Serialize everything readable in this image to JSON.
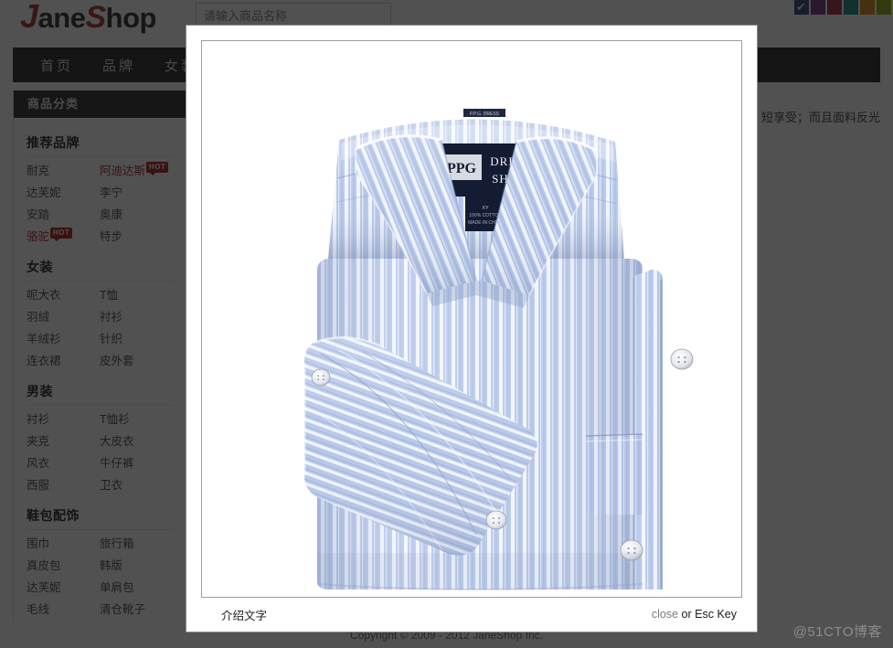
{
  "site": {
    "logo": {
      "prefix": "J",
      "middle": "ane",
      "accent": "S",
      "suffix": "hop"
    },
    "search": {
      "value": "",
      "placeholder": "请输入商品名称"
    },
    "nav": [
      {
        "label": "首页"
      },
      {
        "label": "品牌"
      },
      {
        "label": "女装"
      }
    ],
    "swatches": [
      {
        "name": "swatch-navy",
        "color": "#1b3a73",
        "selected": true,
        "check": "✔"
      },
      {
        "name": "swatch-purple",
        "color": "#6d1f7a"
      },
      {
        "name": "swatch-crimson",
        "color": "#9d1430"
      },
      {
        "name": "swatch-teal",
        "color": "#0d7f80"
      },
      {
        "name": "swatch-orange",
        "color": "#d98100"
      },
      {
        "name": "swatch-olive",
        "color": "#8aa200"
      }
    ],
    "sidebar": {
      "header": "商品分类",
      "sections": [
        {
          "title": "推荐品牌",
          "links": [
            {
              "label": "耐克",
              "hot": false
            },
            {
              "label": "阿迪达斯",
              "hot": true,
              "badge": "HOT"
            },
            {
              "label": "达芙妮",
              "hot": false
            },
            {
              "label": "李宁",
              "hot": false
            },
            {
              "label": "安踏",
              "hot": false
            },
            {
              "label": "奥康",
              "hot": false
            },
            {
              "label": "骆驼",
              "hot": true,
              "badge": "HOT"
            },
            {
              "label": "特步",
              "hot": false
            }
          ]
        },
        {
          "title": "女装",
          "links": [
            {
              "label": "呢大衣",
              "hot": false
            },
            {
              "label": "T恤",
              "hot": false
            },
            {
              "label": "羽绒",
              "hot": false
            },
            {
              "label": "衬衫",
              "hot": false
            },
            {
              "label": "羊绒衫",
              "hot": false
            },
            {
              "label": "针织",
              "hot": false
            },
            {
              "label": "连衣裙",
              "hot": false
            },
            {
              "label": "皮外套",
              "hot": false
            }
          ]
        },
        {
          "title": "男装",
          "links": [
            {
              "label": "衬衫",
              "hot": false
            },
            {
              "label": "T恤衫",
              "hot": false
            },
            {
              "label": "夹克",
              "hot": false
            },
            {
              "label": "大皮衣",
              "hot": false
            },
            {
              "label": "风衣",
              "hot": false
            },
            {
              "label": "牛仔裤",
              "hot": false
            },
            {
              "label": "西服",
              "hot": false
            },
            {
              "label": "卫衣",
              "hot": false
            }
          ]
        },
        {
          "title": "鞋包配饰",
          "links": [
            {
              "label": "围巾",
              "hot": false
            },
            {
              "label": "旅行箱",
              "hot": false
            },
            {
              "label": "真皮包",
              "hot": false
            },
            {
              "label": "韩版",
              "hot": false
            },
            {
              "label": "达芙妮",
              "hot": false
            },
            {
              "label": "单肩包",
              "hot": false
            },
            {
              "label": "毛线",
              "hot": false
            },
            {
              "label": "清仓靴子",
              "hot": false
            }
          ]
        }
      ]
    },
    "product_description": "棉织造而成，平整度好，短享受；而且面料反光效果!",
    "footer": "Copyright © 2009 - 2012 JaneShop Inc."
  },
  "modal": {
    "caption": "介绍文字",
    "close_label": "close",
    "close_suffix": " or Esc Key",
    "image": {
      "alt": "folded light-blue striped dress shirt",
      "brand_label": "PPG",
      "brand_text_line1": "DRESS",
      "brand_text_line2": "SHIRT",
      "fabric_color": "#b9c9e8",
      "stripe_color": "#ffffff"
    }
  },
  "watermark": "@51CTO博客"
}
